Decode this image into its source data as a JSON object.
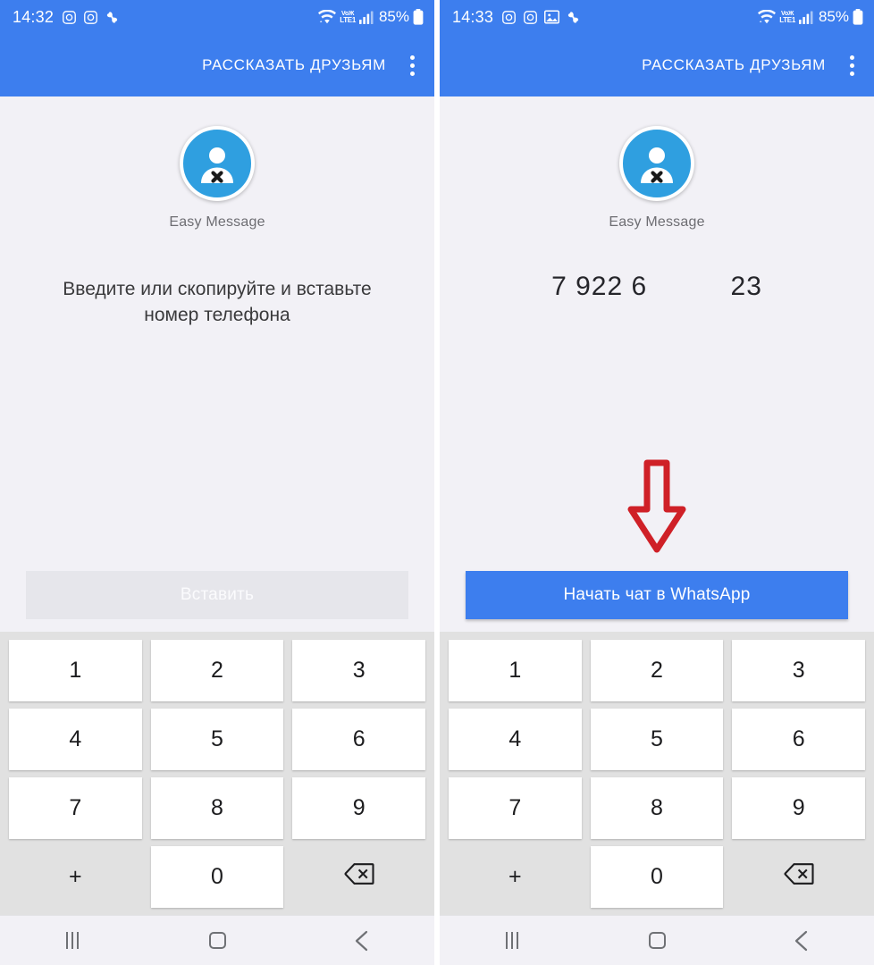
{
  "panels": [
    {
      "id": "left",
      "status": {
        "time": "14:32",
        "left_icons": [
          "instagram-icon",
          "instagram-icon",
          "pinwheel-icon"
        ],
        "wifi_icon": "wifi-icon",
        "volte_top": "VoЖ",
        "volte_bottom": "LTE1",
        "signal_icon": "signal-bars-icon",
        "battery_text": "85%",
        "battery_icon": "battery-icon"
      },
      "toolbar": {
        "action_label": "РАССКАЗАТЬ ДРУЗЬЯМ",
        "overflow_icon": "overflow-menu-icon"
      },
      "brand": {
        "icon": "app-avatar-icon",
        "name": "Easy Message"
      },
      "hint_text": "Введите или скопируйте и вставьте номер телефона",
      "phone_number": "",
      "show_hint": true,
      "show_number": false,
      "show_arrow": false,
      "cta": {
        "label": "Вставить",
        "state": "disabled"
      }
    },
    {
      "id": "right",
      "status": {
        "time": "14:33",
        "left_icons": [
          "instagram-icon",
          "instagram-icon",
          "image-icon",
          "pinwheel-icon"
        ],
        "wifi_icon": "wifi-icon",
        "volte_top": "VoЖ",
        "volte_bottom": "LTE1",
        "signal_icon": "signal-bars-icon",
        "battery_text": "85%",
        "battery_icon": "battery-icon"
      },
      "toolbar": {
        "action_label": "РАССКАЗАТЬ ДРУЗЬЯМ",
        "overflow_icon": "overflow-menu-icon"
      },
      "brand": {
        "icon": "app-avatar-icon",
        "name": "Easy Message"
      },
      "hint_text": "",
      "phone_number": "7 922 6          23",
      "show_hint": false,
      "show_number": true,
      "show_arrow": true,
      "cta": {
        "label": "Начать чат в WhatsApp",
        "state": "primary"
      }
    }
  ],
  "keypad": {
    "keys": [
      {
        "label": "1",
        "name": "key-1",
        "card": true
      },
      {
        "label": "2",
        "name": "key-2",
        "card": true
      },
      {
        "label": "3",
        "name": "key-3",
        "card": true
      },
      {
        "label": "4",
        "name": "key-4",
        "card": true
      },
      {
        "label": "5",
        "name": "key-5",
        "card": true
      },
      {
        "label": "6",
        "name": "key-6",
        "card": true
      },
      {
        "label": "7",
        "name": "key-7",
        "card": true
      },
      {
        "label": "8",
        "name": "key-8",
        "card": true
      },
      {
        "label": "9",
        "name": "key-9",
        "card": true
      },
      {
        "label": "+",
        "name": "key-plus",
        "card": false
      },
      {
        "label": "0",
        "name": "key-0",
        "card": true
      },
      {
        "label": "backspace-icon",
        "name": "key-backspace",
        "card": false,
        "icon": true
      }
    ]
  },
  "navbar": {
    "recents_icon": "recents-icon",
    "home_icon": "home-icon",
    "back_icon": "back-icon"
  },
  "colors": {
    "accent_blue": "#3d7eee",
    "screen_bg": "#f2f1f6",
    "keypad_bg": "#e1e1e1",
    "arrow_red": "#cf2027",
    "disabled_btn": "#e6e6eb",
    "avatar_blue": "#2f9fe0"
  },
  "annotation": {
    "arrow_icon": "red-down-arrow-annotation",
    "arrow_color": "#cf2027"
  }
}
